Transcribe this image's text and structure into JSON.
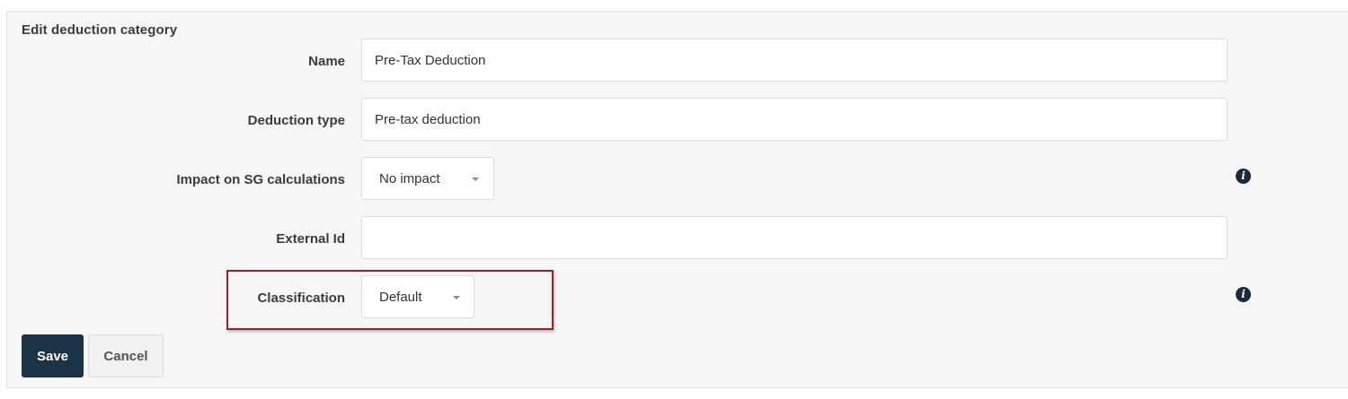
{
  "form": {
    "title": "Edit deduction category",
    "name": {
      "label": "Name",
      "value": "Pre-Tax Deduction"
    },
    "deduction_type": {
      "label": "Deduction type",
      "value": "Pre-tax deduction"
    },
    "impact_sg": {
      "label": "Impact on SG calculations",
      "value": "No impact"
    },
    "external_id": {
      "label": "External Id",
      "value": ""
    },
    "classification": {
      "label": "Classification",
      "value": "Default"
    },
    "info_glyph": "i"
  },
  "actions": {
    "save_label": "Save",
    "cancel_label": "Cancel"
  },
  "colors": {
    "panel_bg": "#f6f6f6",
    "save_bg": "#1b3347",
    "highlight_border": "#a01f24",
    "info_icon": "#1b2a3a"
  },
  "icons": [
    "info-icon",
    "chevron-down-icon"
  ]
}
